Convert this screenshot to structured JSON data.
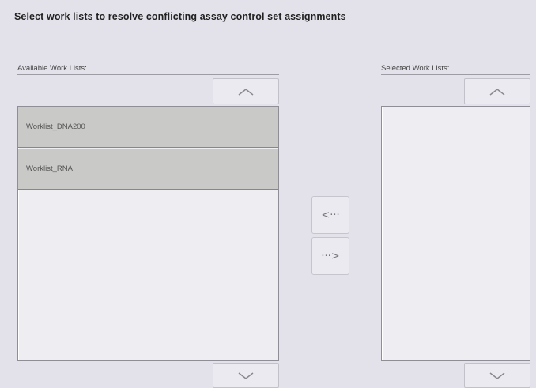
{
  "header": {
    "title": "Select work lists to resolve conflicting assay control set assignments"
  },
  "available": {
    "label": "Available Work Lists:",
    "items": [
      {
        "label": "Worklist_DNA200"
      },
      {
        "label": "Worklist_RNA"
      }
    ]
  },
  "selected": {
    "label": "Selected Work Lists:",
    "items": []
  },
  "transfer": {
    "move_left_glyph": "<···",
    "move_right_glyph": "···>"
  },
  "icons": {
    "scroll_up": "chevron-up-icon",
    "scroll_down": "chevron-down-icon"
  },
  "colors": {
    "background": "#e3e2ea",
    "list_item": "#c9cac7",
    "list_box": "#eeedf2"
  }
}
